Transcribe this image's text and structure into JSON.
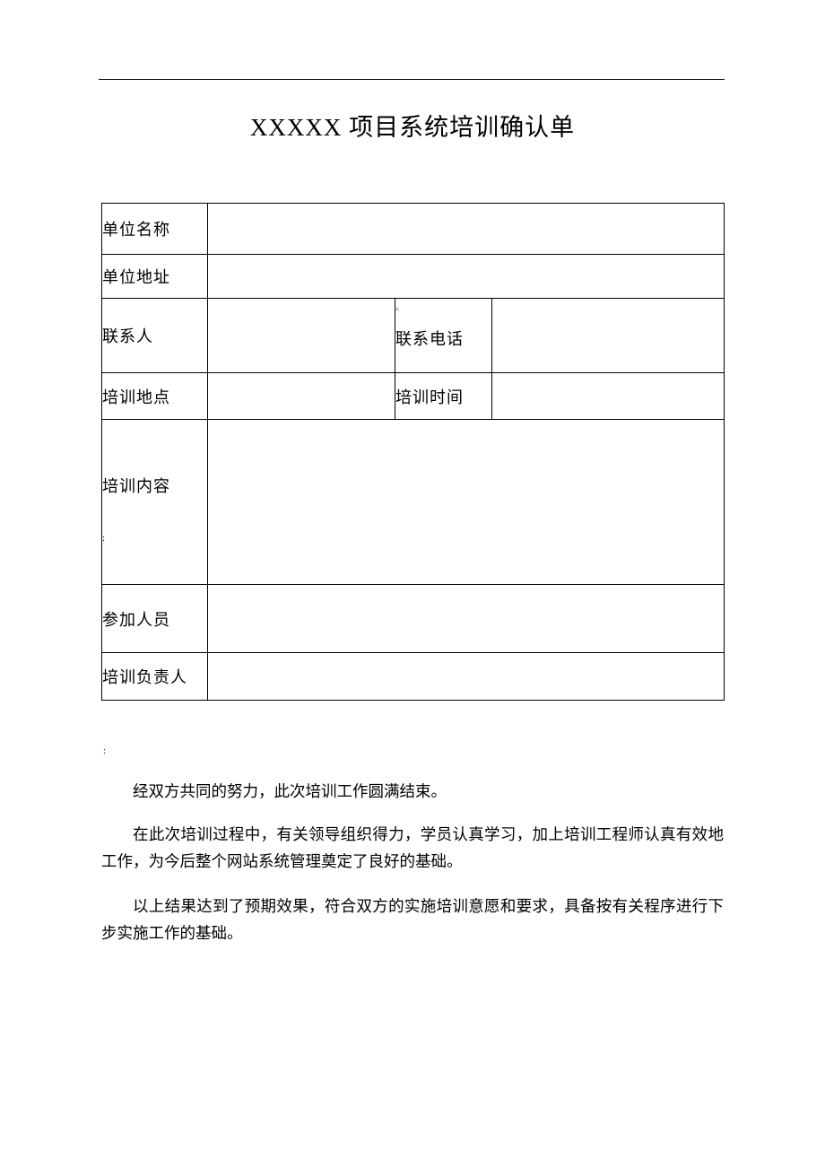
{
  "title": "XXXXX 项目系统培训确认单",
  "form": {
    "unit_name_label": "单位名称",
    "unit_address_label": "单位地址",
    "contact_person_label": "联系人",
    "contact_phone_label": "联系电话",
    "training_place_label": "培训地点",
    "training_time_label": "培训时间",
    "training_content_label": "培训内容",
    "participants_label": "参加人员",
    "training_leader_label": "培训负责人",
    "content_colon": ":",
    "contact_sup": "^",
    "unit_name_value": "",
    "unit_address_value": "",
    "contact_person_value": "",
    "contact_phone_value": "",
    "training_place_value": "",
    "training_time_value": "",
    "training_content_value": "",
    "participants_value": "",
    "training_leader_value": ""
  },
  "post_table_mark": ":",
  "paragraphs": {
    "p1": "经双方共同的努力，此次培训工作圆满结束。",
    "p2": "在此次培训过程中，有关领导组织得力，学员认真学习，加上培训工程师认真有效地工作，为今后整个网站系统管理奠定了良好的基础。",
    "p3": "以上结果达到了预期效果，符合双方的实施培训意愿和要求，具备按有关程序进行下步实施工作的基础。"
  }
}
